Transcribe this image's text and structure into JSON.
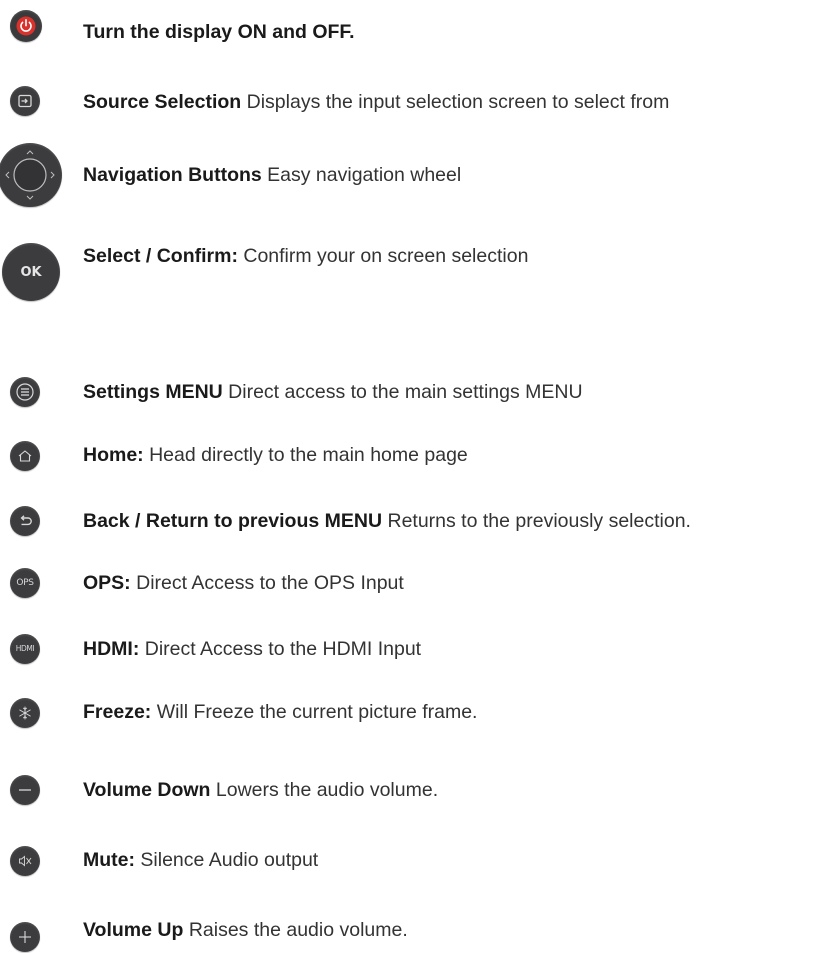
{
  "items": [
    {
      "icon": "power-icon",
      "title": "Turn the display ON and OFF.",
      "text": ""
    },
    {
      "icon": "source-icon",
      "title": "Source Selection",
      "text": " Displays the input selection screen to select from"
    },
    {
      "icon": "navigation-wheel-icon",
      "title": "Navigation Buttons",
      "text": " Easy navigation wheel"
    },
    {
      "icon": "ok-icon",
      "button_label": "OK",
      "title": "Select / Confirm:",
      "text": " Confirm your on screen selection"
    },
    {
      "icon": "menu-icon",
      "title": "Settings MENU",
      "text": " Direct access to the main settings MENU"
    },
    {
      "icon": "home-icon",
      "title": "Home:",
      "text": " Head directly to the main home page"
    },
    {
      "icon": "back-icon",
      "title": "Back / Return to previous MENU",
      "text": " Returns to the previously selection."
    },
    {
      "icon": "ops-icon",
      "button_label": "OPS",
      "title": "OPS:",
      "text": " Direct Access to the OPS Input"
    },
    {
      "icon": "hdmi-icon",
      "button_label": "HDMI",
      "title": "HDMI:",
      "text": " Direct Access to the HDMI Input"
    },
    {
      "icon": "freeze-icon",
      "title": "Freeze:",
      "text": " Will Freeze the current picture frame."
    },
    {
      "icon": "volume-down-icon",
      "title": "Volume Down",
      "text": " Lowers the audio volume."
    },
    {
      "icon": "mute-icon",
      "title": "Mute:",
      "text": " Silence Audio output"
    },
    {
      "icon": "volume-up-icon",
      "title": "Volume Up",
      "text": " Raises the audio volume."
    }
  ],
  "colors": {
    "button": "#3c3c3e",
    "power_accent": "#d9322c",
    "icon_light": "#d8d8d8"
  }
}
